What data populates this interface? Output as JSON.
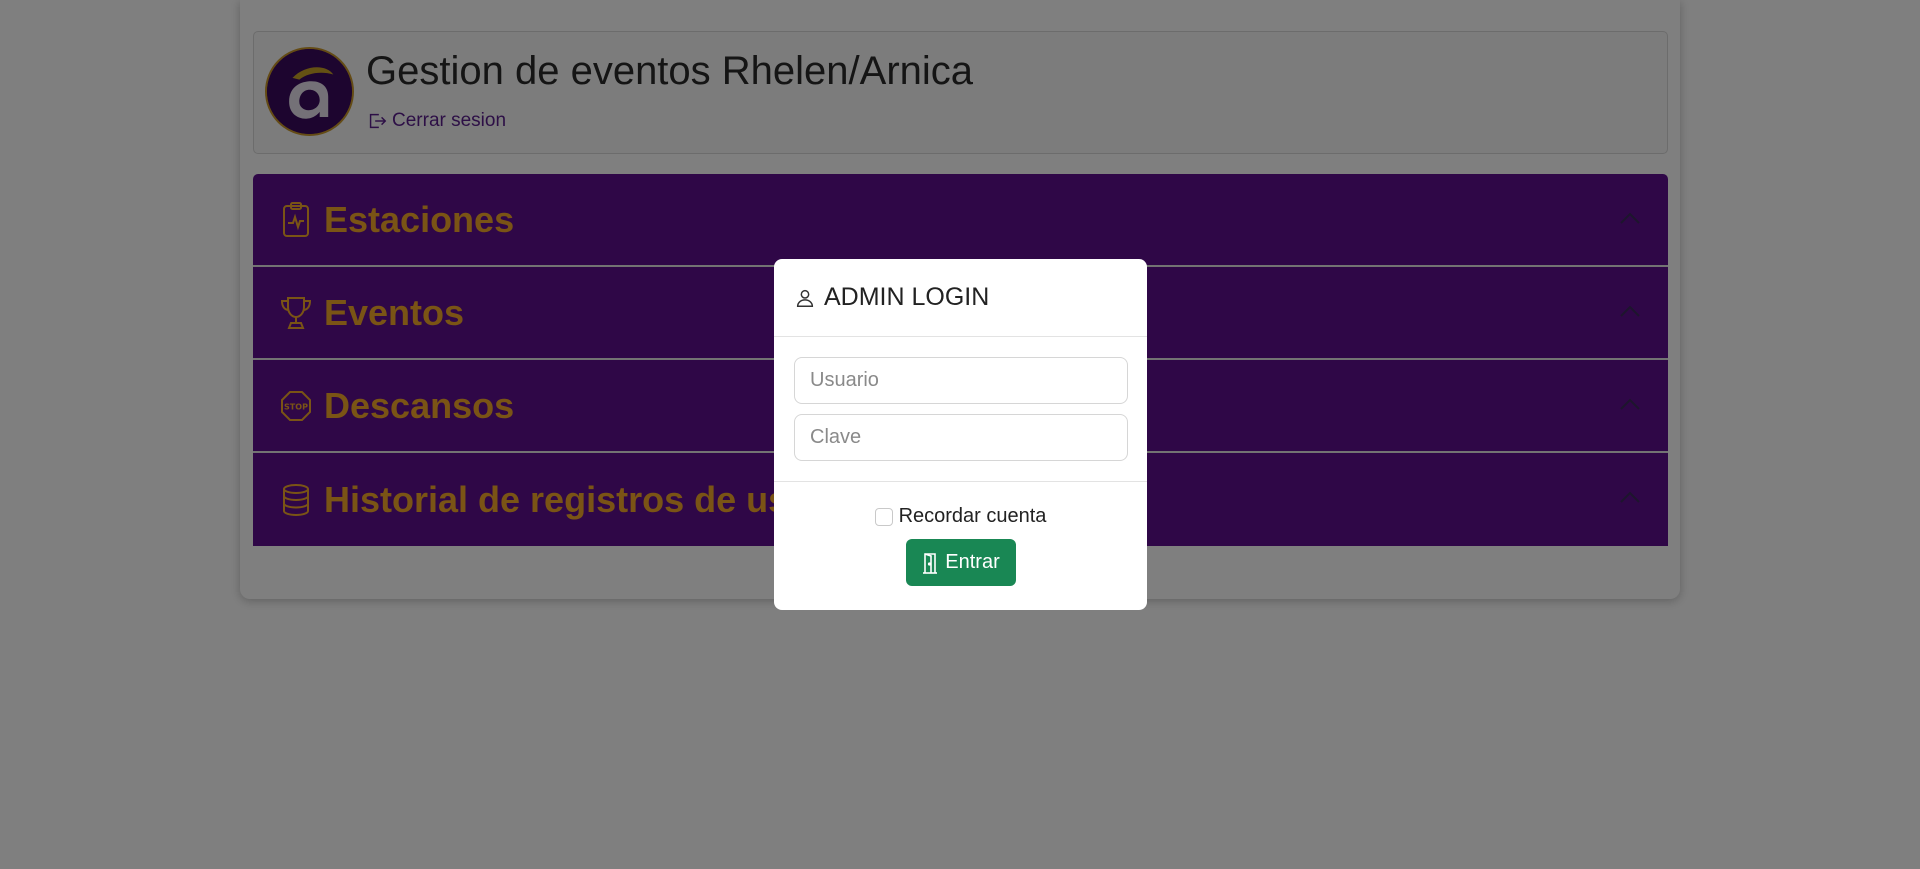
{
  "header": {
    "title": "Gestion de eventos Rhelen/Arnica",
    "logout_label": "Cerrar sesion"
  },
  "accordion": {
    "items": [
      {
        "label": "Estaciones",
        "icon": "clipboard-pulse-icon"
      },
      {
        "label": "Eventos",
        "icon": "trophy-icon"
      },
      {
        "label": "Descansos",
        "icon": "stop-sign-icon"
      },
      {
        "label": "Historial de registros de usuarios",
        "icon": "database-icon"
      }
    ]
  },
  "modal": {
    "title": "ADMIN LOGIN",
    "username_placeholder": "Usuario",
    "password_placeholder": "Clave",
    "remember_label": "Recordar cuenta",
    "submit_label": "Entrar"
  },
  "colors": {
    "accordion_bg": "#5e0f8f",
    "accordion_text": "#f5a92a",
    "logout_link": "#5a1f8c",
    "submit_bg": "#198754",
    "overlay": "rgba(0,0,0,0.5)"
  }
}
